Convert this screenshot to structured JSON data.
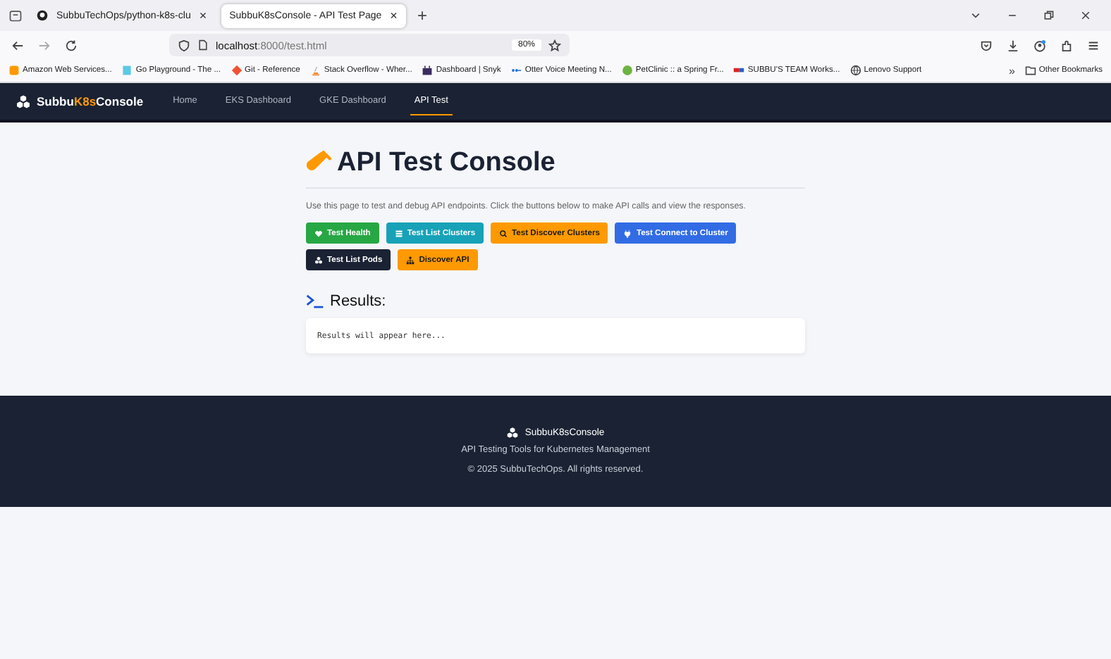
{
  "browser": {
    "tabs": [
      {
        "title": "SubbuTechOps/python-k8s-clu",
        "selected": false,
        "close": "×"
      },
      {
        "title": "SubbuK8sConsole - API Test Page",
        "selected": true,
        "close": "×"
      }
    ],
    "new_tab": "+",
    "url": {
      "host": "localhost",
      "path": ":8000/test.html"
    },
    "zoom": "80%",
    "bookmarks": [
      "Amazon Web Services...",
      "Go Playground - The ...",
      "Git - Reference",
      "Stack Overflow - Wher...",
      "Dashboard | Snyk",
      "Otter Voice Meeting N...",
      "PetClinic :: a Spring Fr...",
      "SUBBU'S TEAM Works...",
      "Lenovo Support"
    ],
    "overflow": "»",
    "other_bookmarks": "Other Bookmarks"
  },
  "nav": {
    "brand": {
      "prefix": "Subbu",
      "accent": "K8s",
      "suffix": "Console"
    },
    "links": [
      {
        "label": "Home",
        "selected": false
      },
      {
        "label": "EKS Dashboard",
        "selected": false
      },
      {
        "label": "GKE Dashboard",
        "selected": false
      },
      {
        "label": "API Test",
        "selected": true
      }
    ]
  },
  "page": {
    "title": "API Test Console",
    "description": "Use this page to test and debug API endpoints. Click the buttons below to make API calls and view the responses.",
    "buttons": [
      {
        "label": "Test Health",
        "kind": "heart",
        "color": "#28a745"
      },
      {
        "label": "Test List Clusters",
        "kind": "list",
        "color": "#17a2b8"
      },
      {
        "label": "Test Discover Clusters",
        "kind": "search",
        "color": "#ff9900"
      },
      {
        "label": "Test Connect to Cluster",
        "kind": "plug",
        "color": "#326ce5"
      },
      {
        "label": "Test List Pods",
        "kind": "cubes",
        "color": "#1a2233"
      },
      {
        "label": "Discover API",
        "kind": "sitemap",
        "color": "#ff9900"
      }
    ],
    "results_heading": "Results:",
    "results_text": "Results will appear here..."
  },
  "footer": {
    "brand": "SubbuK8sConsole",
    "tagline": "API Testing Tools for Kubernetes Management",
    "copyright": "© 2025 SubbuTechOps. All rights reserved."
  }
}
